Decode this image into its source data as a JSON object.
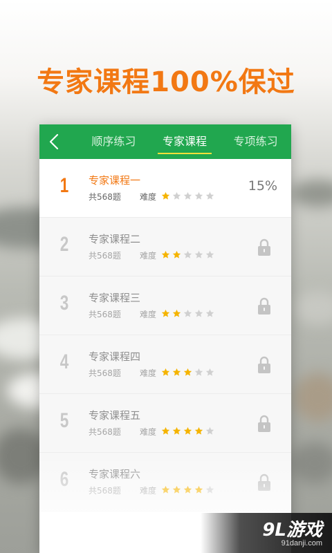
{
  "headline": "专家课程100%保过",
  "colors": {
    "accent_orange": "#f27813",
    "header_green": "#21a74f",
    "star_filled": "#f5b400",
    "star_empty": "#d0d0d0"
  },
  "header": {
    "back_icon": "chevron-left-icon",
    "tabs": [
      {
        "label": "顺序练习",
        "active": false
      },
      {
        "label": "专家课程",
        "active": true
      },
      {
        "label": "专项练习",
        "active": false
      }
    ]
  },
  "courses": [
    {
      "number": "1",
      "title": "专家课程一",
      "count": "共568题",
      "difficulty_label": "难度",
      "rating": 1,
      "progress": "15%",
      "locked": false
    },
    {
      "number": "2",
      "title": "专家课程二",
      "count": "共568题",
      "difficulty_label": "难度",
      "rating": 2,
      "locked": true
    },
    {
      "number": "3",
      "title": "专家课程三",
      "count": "共568题",
      "difficulty_label": "难度",
      "rating": 2,
      "locked": true
    },
    {
      "number": "4",
      "title": "专家课程四",
      "count": "共568题",
      "difficulty_label": "难度",
      "rating": 3,
      "locked": true
    },
    {
      "number": "5",
      "title": "专家课程五",
      "count": "共568题",
      "difficulty_label": "难度",
      "rating": 4,
      "locked": true
    },
    {
      "number": "6",
      "title": "专家课程六",
      "count": "共568题",
      "difficulty_label": "难度",
      "rating": 4,
      "locked": true
    }
  ],
  "watermark": {
    "logo": "9L游戏",
    "url": "91danji.com"
  }
}
